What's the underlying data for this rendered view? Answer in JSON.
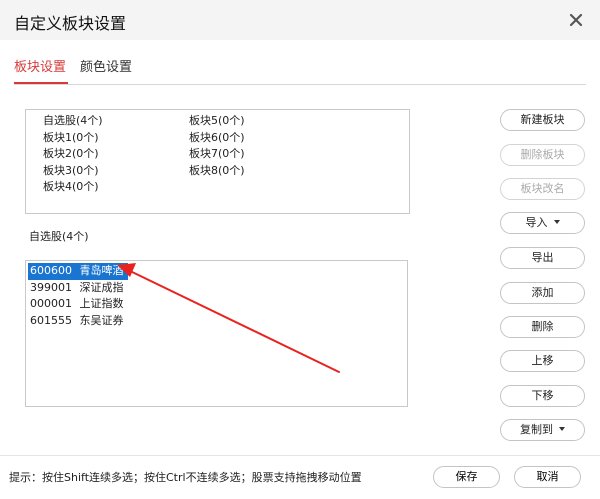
{
  "dialog": {
    "title": "自定义板块设置"
  },
  "tabs": [
    {
      "label": "板块设置",
      "active": true
    },
    {
      "label": "颜色设置",
      "active": false
    }
  ],
  "blocks": {
    "column1": [
      "自选股(4个)",
      "板块1(0个)",
      "板块2(0个)",
      "板块3(0个)",
      "板块4(0个)"
    ],
    "column2": [
      "板块5(0个)",
      "板块6(0个)",
      "板块7(0个)",
      "板块8(0个)"
    ]
  },
  "selected_block_label": "自选股(4个)",
  "stocks": [
    {
      "code": "600600",
      "name": "青岛啤酒",
      "selected": true
    },
    {
      "code": "399001",
      "name": "深证成指",
      "selected": false
    },
    {
      "code": "000001",
      "name": "上证指数",
      "selected": false
    },
    {
      "code": "601555",
      "name": "东吴证券",
      "selected": false
    }
  ],
  "buttons": {
    "new_block": "新建板块",
    "delete_block": "删除板块",
    "rename_block": "板块改名",
    "import": "导入",
    "export": "导出",
    "add": "添加",
    "delete": "删除",
    "move_up": "上移",
    "move_down": "下移",
    "copy_to": "复制到"
  },
  "footer": {
    "tip": "提示：按住Shift连续多选；按住Ctrl不连续多选；股票支持拖拽移动位置",
    "save": "保存",
    "cancel": "取消"
  },
  "colors": {
    "accent": "#d63b3b",
    "selection": "#1a75d1",
    "annotation_arrow": "#e8231f"
  }
}
